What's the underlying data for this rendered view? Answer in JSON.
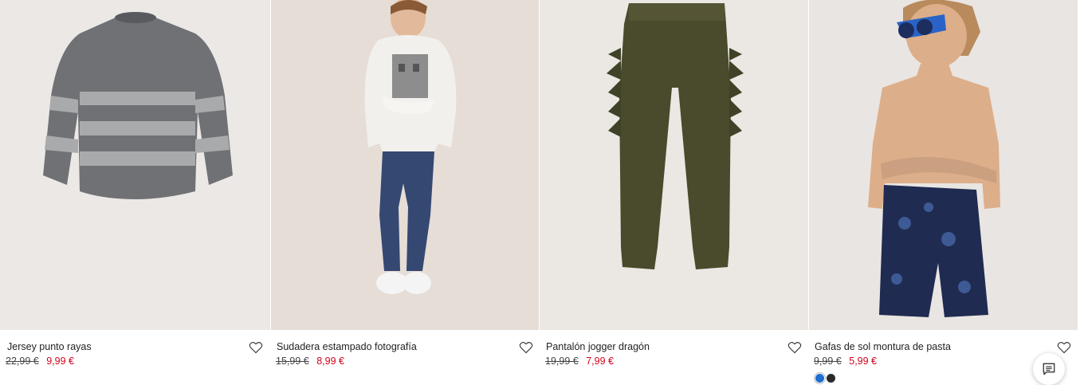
{
  "products": [
    {
      "name": "Jersey punto rayas",
      "old_price": "22,99 €",
      "new_price": "9,99 €",
      "image_icon": "striped-sweater-photo",
      "bg": "#ece8e5"
    },
    {
      "name": "Sudadera estampado fotografía",
      "old_price": "15,99 €",
      "new_price": "8,99 €",
      "image_icon": "boy-in-sweatshirt-photo",
      "bg": "#e6ddd7"
    },
    {
      "name": "Pantalón jogger dragón",
      "old_price": "19,99 €",
      "new_price": "7,99 €",
      "image_icon": "dragon-jogger-pants-photo",
      "bg": "#ebe7e3"
    },
    {
      "name": "Gafas de sol montura de pasta",
      "old_price": "9,99 €",
      "new_price": "5,99 €",
      "image_icon": "boy-with-sunglasses-photo",
      "bg": "#e9e5e2",
      "swatches": [
        "#1e6fd0",
        "#2a2a2a"
      ]
    }
  ],
  "colors": {
    "sale": "#d0021b",
    "text": "#222222"
  },
  "chat": {
    "icon": "chat-icon"
  }
}
